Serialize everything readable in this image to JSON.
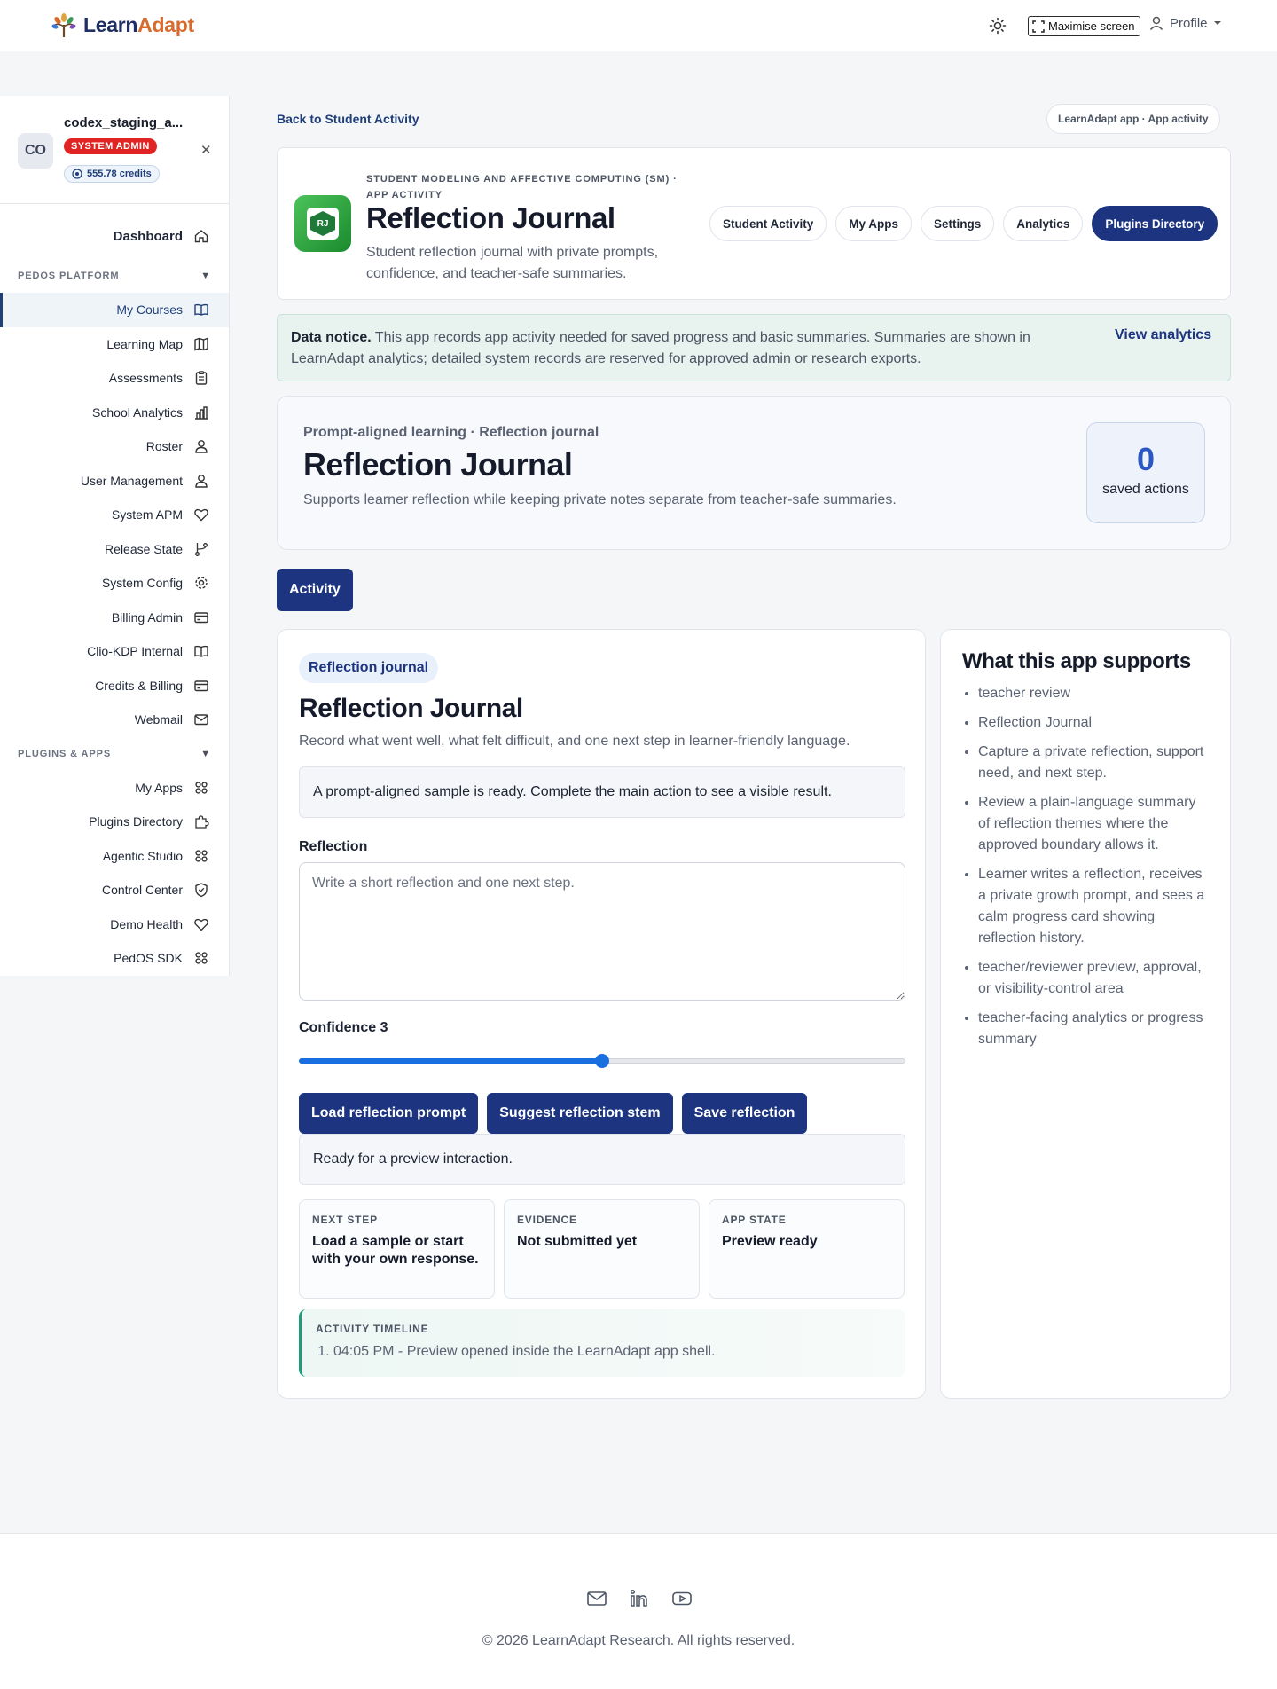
{
  "header": {
    "brand_name_1": "Learn",
    "brand_name_2": "Adapt",
    "maximise_label": "Maximise screen",
    "profile_label": "Profile"
  },
  "sidebar": {
    "user": {
      "initials": "CO",
      "name": "codex_staging_a...",
      "role": "SYSTEM ADMIN",
      "credits": "555.78 credits"
    },
    "dashboard": "Dashboard",
    "sections": [
      {
        "title": "PEDOS PLATFORM",
        "items": [
          {
            "label": "My Courses",
            "icon": "book-icon",
            "active": true
          },
          {
            "label": "Learning Map",
            "icon": "map-icon"
          },
          {
            "label": "Assessments",
            "icon": "clipboard-icon"
          },
          {
            "label": "School Analytics",
            "icon": "bar-chart-icon"
          },
          {
            "label": "Roster",
            "icon": "users-icon"
          },
          {
            "label": "User Management",
            "icon": "users-icon"
          },
          {
            "label": "System APM",
            "icon": "heart-icon"
          },
          {
            "label": "Release State",
            "icon": "git-branch-icon"
          },
          {
            "label": "System Config",
            "icon": "gear-icon"
          },
          {
            "label": "Billing Admin",
            "icon": "credit-card-icon"
          },
          {
            "label": "Clio-KDP Internal",
            "icon": "book-icon"
          },
          {
            "label": "Credits & Billing",
            "icon": "credit-card-icon"
          },
          {
            "label": "Webmail",
            "icon": "mail-icon"
          }
        ]
      },
      {
        "title": "PLUGINS & APPS",
        "items": [
          {
            "label": "My Apps",
            "icon": "grid-icon"
          },
          {
            "label": "Plugins Directory",
            "icon": "puzzle-icon"
          },
          {
            "label": "Agentic Studio",
            "icon": "grid-icon"
          },
          {
            "label": "Control Center",
            "icon": "shield-icon"
          },
          {
            "label": "Demo Health",
            "icon": "heart-icon"
          },
          {
            "label": "PedOS SDK",
            "icon": "grid-icon"
          }
        ]
      }
    ]
  },
  "main": {
    "back_link": "Back to Student Activity",
    "crumb": "LearnAdapt app · App activity",
    "app_header": {
      "icon_text": "RJ",
      "eyebrow": "STUDENT MODELING AND AFFECTIVE COMPUTING (SM) · APP ACTIVITY",
      "title": "Reflection Journal",
      "description": "Student reflection journal with private prompts, confidence, and teacher-safe summaries.",
      "tabs": [
        "Student Activity",
        "My Apps",
        "Settings",
        "Analytics",
        "Plugins Directory"
      ]
    },
    "notice": {
      "bold": "Data notice.",
      "text": " This app records app activity needed for saved progress and basic summaries. Summaries are shown in LearnAdapt analytics; detailed system records are reserved for approved admin or research exports.",
      "link": "View analytics"
    },
    "hero": {
      "eyebrow": "Prompt-aligned learning · Reflection journal",
      "title": "Reflection Journal",
      "description": "Supports learner reflection while keeping private notes separate from teacher-safe summaries.",
      "saved_count": "0",
      "saved_label": "saved actions"
    },
    "activity_tab": "Activity",
    "panel": {
      "chip": "Reflection journal",
      "title": "Reflection Journal",
      "description": "Record what went well, what felt difficult, and one next step in learner-friendly language.",
      "sample_notice": "A prompt-aligned sample is ready. Complete the main action to see a visible result.",
      "reflection_label": "Reflection",
      "reflection_placeholder": "Write a short reflection and one next step.",
      "confidence_label": "Confidence 3",
      "confidence_fraction": 0.5,
      "buttons": [
        "Load reflection prompt",
        "Suggest reflection stem",
        "Save reflection"
      ],
      "status": "Ready for a preview interaction.",
      "cards": [
        {
          "label": "NEXT STEP",
          "value": "Load a sample or start with your own response."
        },
        {
          "label": "EVIDENCE",
          "value": "Not submitted yet"
        },
        {
          "label": "APP STATE",
          "value": "Preview ready"
        }
      ],
      "timeline_label": "ACTIVITY TIMELINE",
      "timeline_item": "04:05 PM - Preview opened inside the LearnAdapt app shell."
    },
    "supports": {
      "title": "What this app supports",
      "items": [
        "teacher review",
        "Reflection Journal",
        "Capture a private reflection, support need, and next step.",
        "Review a plain-language summary of reflection themes where the approved boundary allows it.",
        "Learner writes a reflection, receives a private growth prompt, and sees a calm progress card showing reflection history.",
        "teacher/reviewer preview, approval, or visibility-control area",
        "teacher-facing analytics or progress summary"
      ]
    }
  },
  "footer": {
    "copyright": "© 2026 LearnAdapt Research. All rights reserved."
  },
  "colors": {
    "primary": "#1d3580",
    "danger": "#e02424",
    "accent_orange": "#d86a2b",
    "slider": "#1a6fe0",
    "timeline_accent": "#1f9d7a"
  }
}
